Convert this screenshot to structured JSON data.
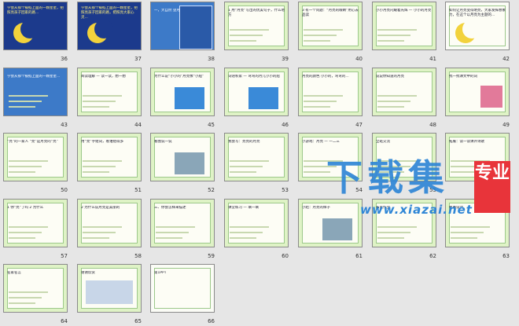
{
  "view": "slide-sorter",
  "slides": [
    {
      "num": "36",
      "theme": "dark",
      "text": "学会从那个被掐上面的一颗星星，把照亮孩子回家的路...",
      "accent": "moon"
    },
    {
      "num": "37",
      "theme": "dark",
      "text": "学会从那个被掐上面的一颗星星，把照亮孩子回家的路，把照亮大家心灵...",
      "accent": "moon"
    },
    {
      "num": "38",
      "theme": "blue",
      "text": "一，大自然  望月亮  三幅画面",
      "accent": "panel"
    },
    {
      "num": "39",
      "theme": "leaf",
      "text": "1 用“月亮”写出的优美句子，什么地方",
      "accent": ""
    },
    {
      "num": "40",
      "theme": "leaf",
      "text": "3 有一个问题：“月亮的眼睛”用心去品读",
      "accent": ""
    },
    {
      "num": "41",
      "theme": "leaf",
      "text": "小小月亮闪耀着光辉 — 小小的月亮",
      "accent": ""
    },
    {
      "num": "42",
      "theme": "white",
      "text": "如何让月亮变得明亮，大家发挥想象力，在这个以月亮为主题的...",
      "accent": "moon"
    },
    {
      "num": "43",
      "theme": "blue",
      "text": "学会从那个被掐上面的一颗星星...",
      "accent": ""
    },
    {
      "num": "44",
      "theme": "leaf",
      "text": "阅读理解 — 读一读，想一想",
      "accent": ""
    },
    {
      "num": "45",
      "theme": "leaf",
      "text": "为什么说“小小的”月亮像“小船”",
      "accent": "sky"
    },
    {
      "num": "46",
      "theme": "leaf",
      "text": "词语积累 — 弯弯的月儿小小的船",
      "accent": "sky"
    },
    {
      "num": "47",
      "theme": "leaf",
      "text": "月亮的颜色 小小的，弯弯的...",
      "accent": ""
    },
    {
      "num": "48",
      "theme": "leaf",
      "text": "说说你知道的月亮",
      "accent": ""
    },
    {
      "num": "49",
      "theme": "leaf",
      "text": "找一找课文中的词",
      "accent": "pink"
    },
    {
      "num": "50",
      "theme": "leaf",
      "text": "“亮”的一家人  “亮”是月亮的“亮”",
      "accent": ""
    },
    {
      "num": "51",
      "theme": "leaf",
      "text": "用“亮”字组词，看谁组得多",
      "accent": ""
    },
    {
      "num": "52",
      "theme": "leaf",
      "text": "看图说一说",
      "accent": "photo"
    },
    {
      "num": "53",
      "theme": "leaf",
      "text": "我会写：亮亮的月亮",
      "accent": ""
    },
    {
      "num": "54",
      "theme": "leaf",
      "text": "小游戏：月亮 — 一二三",
      "accent": ""
    },
    {
      "num": "55",
      "theme": "leaf",
      "text": "全班交流",
      "accent": ""
    },
    {
      "num": "56",
      "theme": "leaf",
      "text": "拓展：读一读课外诗歌",
      "accent": ""
    },
    {
      "num": "57",
      "theme": "leaf",
      "text": "1 你“亮”了吗  2 为什么",
      "accent": ""
    },
    {
      "num": "58",
      "theme": "leaf",
      "text": "2 为什么说月亮是美丽的",
      "accent": ""
    },
    {
      "num": "59",
      "theme": "leaf",
      "text": "三、你会怎样来描述",
      "accent": ""
    },
    {
      "num": "60",
      "theme": "leaf",
      "text": "课堂练习 — 填一填",
      "accent": ""
    },
    {
      "num": "61",
      "theme": "leaf",
      "text": "小结：月亮的样子",
      "accent": "photo"
    },
    {
      "num": "62",
      "theme": "leaf",
      "text": "布置作业",
      "accent": ""
    },
    {
      "num": "63",
      "theme": "leaf",
      "text": "板书设计",
      "accent": ""
    },
    {
      "num": "64",
      "theme": "leaf",
      "text": "名家名言",
      "accent": ""
    },
    {
      "num": "65",
      "theme": "leaf",
      "text": "谢谢欣赏",
      "accent": "books"
    },
    {
      "num": "66",
      "theme": "white",
      "text": "第1PPT",
      "accent": "logo"
    }
  ],
  "watermark": {
    "main": "下载集",
    "badge": "专业",
    "url": "www.xiazai.net"
  }
}
